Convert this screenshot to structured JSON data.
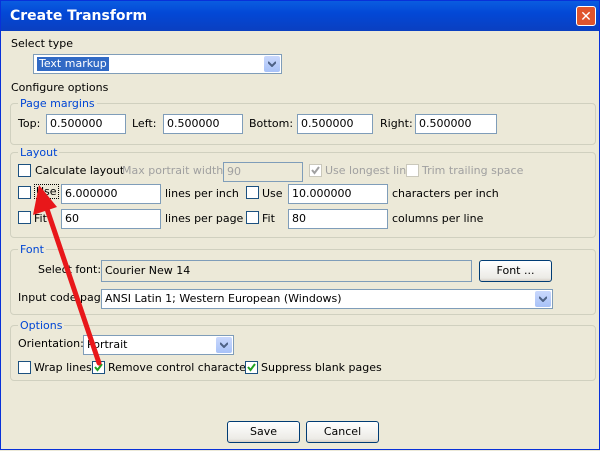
{
  "window": {
    "title": "Create Transform",
    "close_glyph": "✕"
  },
  "select_type": {
    "label": "Select type",
    "value": "Text markup"
  },
  "configure_options_label": "Configure options",
  "page_margins": {
    "title": "Page margins",
    "top_label": "Top:",
    "top_value": "0.500000",
    "left_label": "Left:",
    "left_value": "0.500000",
    "bottom_label": "Bottom:",
    "bottom_value": "0.500000",
    "right_label": "Right:",
    "right_value": "0.500000"
  },
  "layout": {
    "title": "Layout",
    "calculate_layout": {
      "label": "Calculate layout",
      "checked": false
    },
    "max_portrait_width_label": "Max portrait width:",
    "max_portrait_width_value": "90",
    "use_longest_line": {
      "label": "Use longest line",
      "checked": true
    },
    "trim_trailing_space": {
      "label": "Trim trailing space",
      "checked": false
    },
    "use_lpi": {
      "label": "Use",
      "checked": false,
      "value": "6.000000",
      "unit": "lines per inch"
    },
    "use_cpi": {
      "label": "Use",
      "checked": false,
      "value": "10.000000",
      "unit": "characters per inch"
    },
    "fit_lpp": {
      "label": "Fit",
      "checked": false,
      "value": "60",
      "unit": "lines per page"
    },
    "fit_cpl": {
      "label": "Fit",
      "checked": false,
      "value": "80",
      "unit": "columns per line"
    }
  },
  "font": {
    "title": "Font",
    "select_font_label": "Select font:",
    "select_font_value": "Courier New 14",
    "font_button": "Font ...",
    "input_code_page_label": "Input code page:",
    "input_code_page_value": "ANSI Latin 1; Western European (Windows)"
  },
  "options": {
    "title": "Options",
    "orientation_label": "Orientation:",
    "orientation_value": "Portrait",
    "wrap_lines": {
      "label": "Wrap lines",
      "checked": false
    },
    "remove_control_chars": {
      "label": "Remove control characters",
      "checked": true
    },
    "suppress_blank_pages": {
      "label": "Suppress blank pages",
      "checked": true
    }
  },
  "buttons": {
    "save": "Save",
    "cancel": "Cancel"
  },
  "colors": {
    "title_bar": "#0a5de0",
    "group_title": "#0046d5",
    "annotation_arrow": "#e8171a"
  },
  "icons": {
    "dropdown": "chevron-down-icon",
    "check": "checkmark-icon",
    "close": "close-icon"
  }
}
